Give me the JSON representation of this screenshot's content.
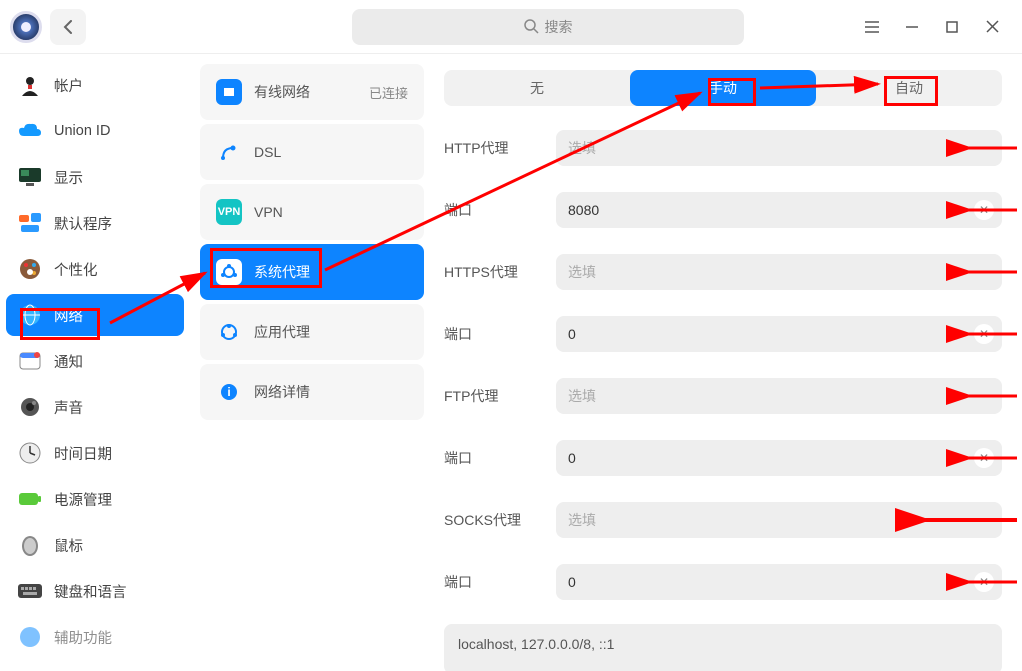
{
  "header": {
    "search_placeholder": "搜索"
  },
  "sidebar": {
    "items": [
      {
        "label": "帐户"
      },
      {
        "label": "Union ID"
      },
      {
        "label": "显示"
      },
      {
        "label": "默认程序"
      },
      {
        "label": "个性化"
      },
      {
        "label": "网络"
      },
      {
        "label": "通知"
      },
      {
        "label": "声音"
      },
      {
        "label": "时间日期"
      },
      {
        "label": "电源管理"
      },
      {
        "label": "鼠标"
      },
      {
        "label": "键盘和语言"
      },
      {
        "label": "辅助功能"
      }
    ]
  },
  "subnav": {
    "items": [
      {
        "label": "有线网络",
        "status": "已连接"
      },
      {
        "label": "DSL"
      },
      {
        "label": "VPN"
      },
      {
        "label": "系统代理"
      },
      {
        "label": "应用代理"
      },
      {
        "label": "网络详情"
      }
    ]
  },
  "proxy": {
    "tabs": {
      "none": "无",
      "manual": "手动",
      "auto": "自动"
    },
    "fields": {
      "http": {
        "label": "HTTP代理",
        "placeholder": "选填",
        "value": ""
      },
      "http_port": {
        "label": "端口",
        "value": "8080"
      },
      "https": {
        "label": "HTTPS代理",
        "placeholder": "选填",
        "value": ""
      },
      "https_port": {
        "label": "端口",
        "value": "0"
      },
      "ftp": {
        "label": "FTP代理",
        "placeholder": "选填",
        "value": ""
      },
      "ftp_port": {
        "label": "端口",
        "value": "0"
      },
      "socks": {
        "label": "SOCKS代理",
        "placeholder": "选填",
        "value": ""
      },
      "socks_port": {
        "label": "端口",
        "value": "0"
      }
    },
    "bypass": "localhost, 127.0.0.0/8, ::1"
  }
}
